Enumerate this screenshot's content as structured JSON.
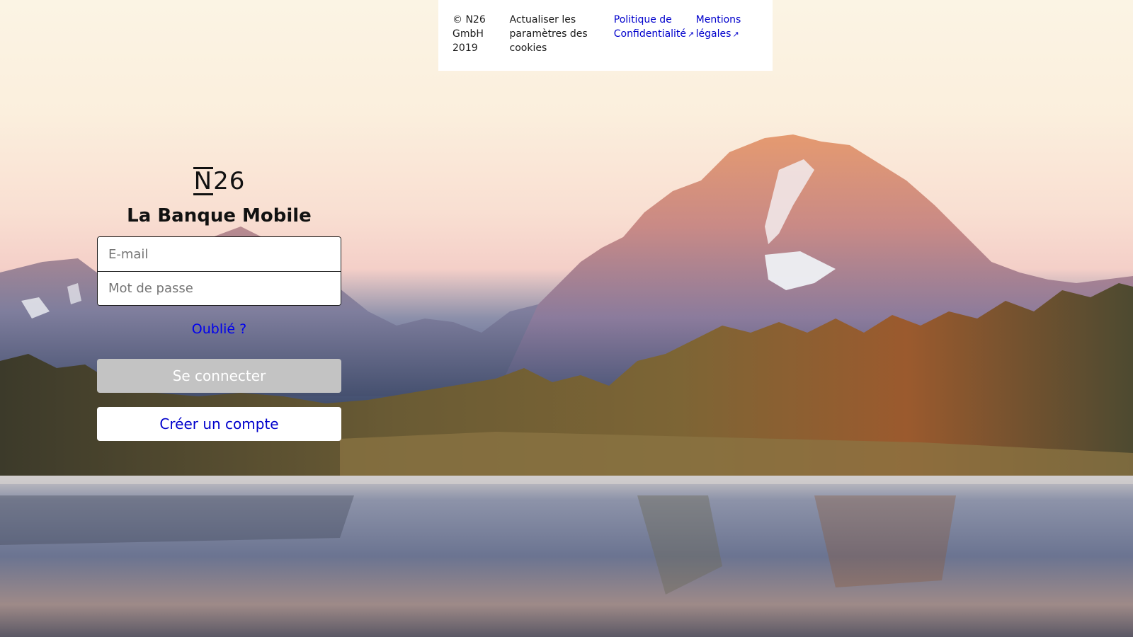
{
  "footer": {
    "copyright": "© N26 GmbH 2019",
    "cookie_settings": "Actualiser les paramètres des cookies",
    "privacy_policy": "Politique de Confidentialité",
    "legal_notice": "Mentions légales",
    "external_link_icon": "external-link-icon",
    "link_color": "#0000cc"
  },
  "login": {
    "logo_n": "N",
    "logo_digits": "26",
    "tagline": "La Banque Mobile",
    "email_placeholder": "E-mail",
    "password_placeholder": "Mot de passe",
    "forgot_label": "Oublié ?",
    "login_button": "Se connecter",
    "create_account_button": "Créer un compte",
    "login_button_color": "#c3c3c3",
    "link_color": "#0000ee"
  }
}
